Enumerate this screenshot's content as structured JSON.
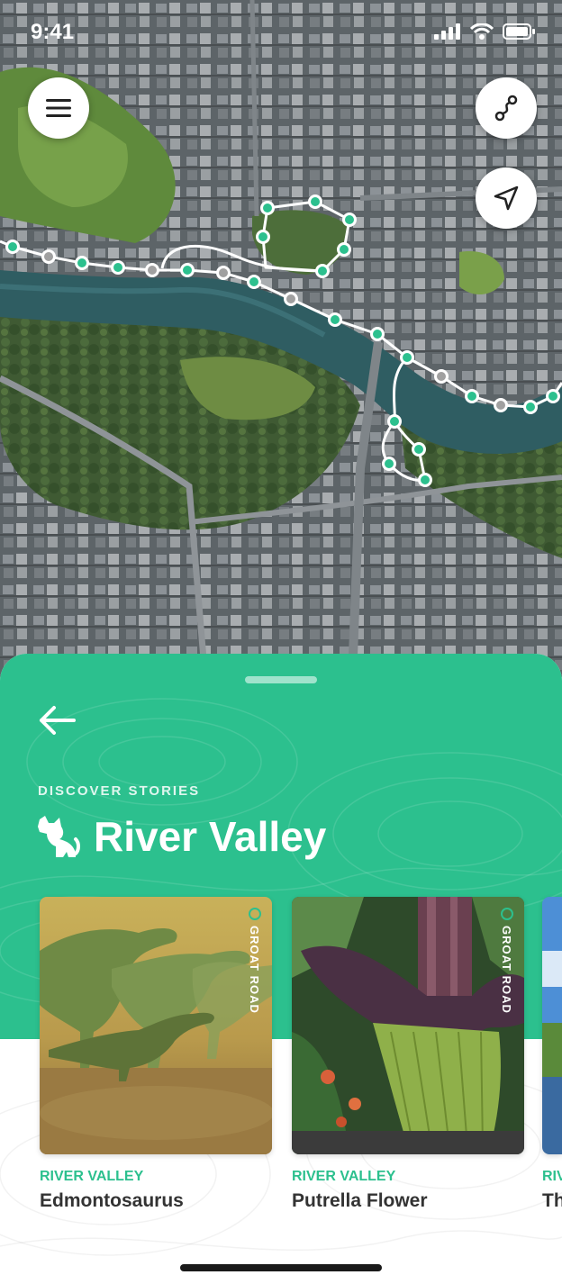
{
  "status_bar": {
    "time": "9:41"
  },
  "map": {
    "route_color": "#ffffff",
    "stop_color": "#2cc08e",
    "visited_stop_color": "#a0a0a0"
  },
  "controls": {
    "menu_icon": "hamburger-menu-icon",
    "route_icon": "route-icon",
    "locate_icon": "navigation-arrow-icon"
  },
  "sheet": {
    "eyebrow": "DISCOVER STORIES",
    "title": "River Valley",
    "title_icon": "dog-icon",
    "accent": "#2cc08e",
    "cards": [
      {
        "tag": "GROAT ROAD",
        "category": "RIVER VALLEY",
        "name": "Edmontosaurus"
      },
      {
        "tag": "GROAT ROAD",
        "category": "RIVER VALLEY",
        "name": "Putrella Flower"
      },
      {
        "tag": "",
        "category": "RIV",
        "name": "Th"
      }
    ]
  }
}
